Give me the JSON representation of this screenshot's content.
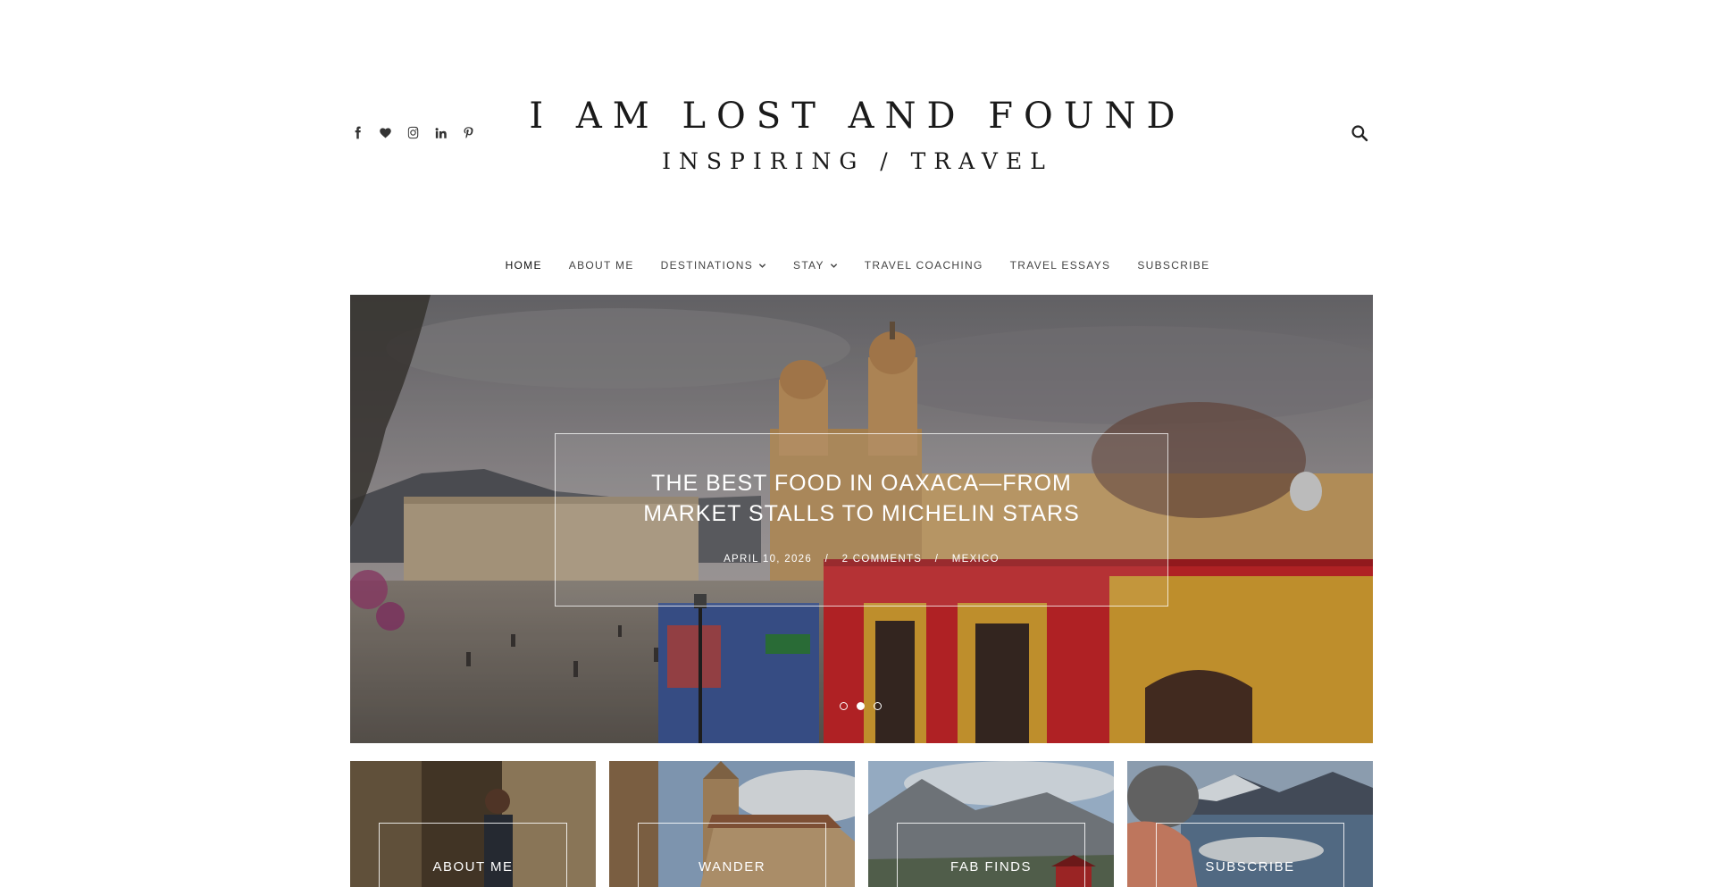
{
  "site": {
    "title": "I AM LOST AND FOUND",
    "tagline": "INSPIRING / TRAVEL"
  },
  "social": [
    {
      "name": "facebook-icon"
    },
    {
      "name": "heart-icon"
    },
    {
      "name": "instagram-icon"
    },
    {
      "name": "linkedin-icon"
    },
    {
      "name": "pinterest-icon"
    }
  ],
  "nav": {
    "items": [
      {
        "label": "HOME",
        "active": true
      },
      {
        "label": "ABOUT ME"
      },
      {
        "label": "DESTINATIONS",
        "dropdown": true
      },
      {
        "label": "STAY",
        "dropdown": true
      },
      {
        "label": "TRAVEL COACHING"
      },
      {
        "label": "TRAVEL ESSAYS"
      },
      {
        "label": "SUBSCRIBE"
      }
    ]
  },
  "hero": {
    "title": "THE BEST FOOD IN OAXACA—FROM MARKET STALLS TO MICHELIN STARS",
    "date": "APRIL 10, 2026",
    "comments": "2 COMMENTS",
    "category": "MEXICO",
    "separator": "/",
    "active_slide": 2,
    "slide_count": 3
  },
  "tiles": [
    {
      "label": "ABOUT ME"
    },
    {
      "label": "WANDER"
    },
    {
      "label": "FAB FINDS"
    },
    {
      "label": "SUBSCRIBE"
    }
  ],
  "colors": {
    "text": "#222222",
    "nav_text": "#444444",
    "hero_red": "#c8262a",
    "hero_yellow": "#d9a233",
    "hero_sky": "#8c8a8e"
  }
}
